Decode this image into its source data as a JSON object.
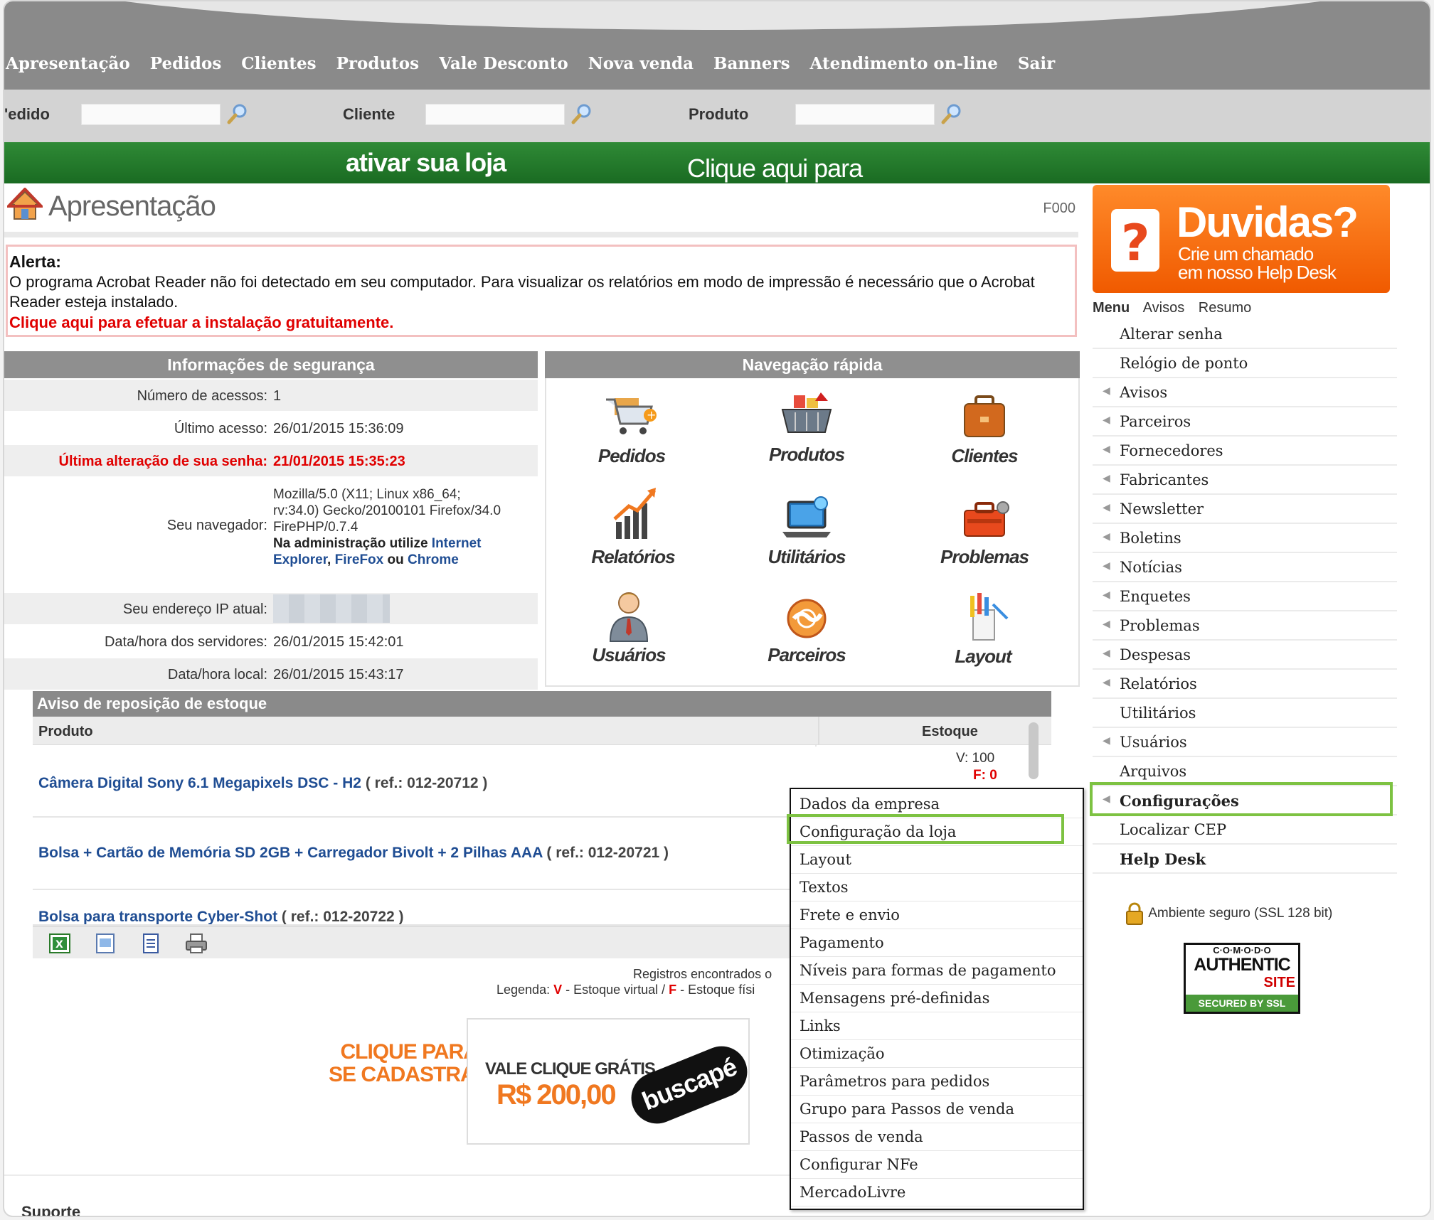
{
  "nav": {
    "items": [
      "Apresentação",
      "Pedidos",
      "Clientes",
      "Produtos",
      "Vale Desconto",
      "Nova venda",
      "Banners",
      "Atendimento on-line",
      "Sair"
    ]
  },
  "search": {
    "pedido_label": "'edido",
    "cliente_label": "Cliente",
    "produto_label": "Produto"
  },
  "banner": {
    "activate_prefix": "Clique aqui para ",
    "activate_bold": "ativar sua loja"
  },
  "page": {
    "title": "Apresentação",
    "code": "F000"
  },
  "alert": {
    "heading": "Alerta:",
    "text": "O programa Acrobat Reader não foi detectado em seu computador. Para visualizar os relatórios em modo de impressão é necessário que o Acrobat Reader esteja instalado.",
    "link": "Clique aqui para efetuar a instalação gratuitamente."
  },
  "security": {
    "heading": "Informações de segurança",
    "access_count_label": "Número de acessos:",
    "access_count": "1",
    "last_access_label": "Último acesso:",
    "last_access": "26/01/2015 15:36:09",
    "pw_change_label": "Última alteração de sua senha:",
    "pw_change": "21/01/2015 15:35:23",
    "browser_label": "Seu navegador:",
    "browser_line1": "Mozilla/5.0 (X11; Linux x86_64;",
    "browser_line2": "rv:34.0) Gecko/20100101 Firefox/34.0",
    "browser_line3": "FirePHP/0.7.4",
    "browser_tip_prefix": "Na administração utilize ",
    "browser_tip_link1": "Internet",
    "browser_tip_link1b": "Explorer",
    "browser_tip_link2": "FireFox",
    "browser_tip_or": " ou ",
    "browser_tip_link3": "Chrome",
    "ip_label": "Seu endereço IP atual:",
    "server_time_label": "Data/hora dos servidores:",
    "server_time": "26/01/2015 15:42:01",
    "local_time_label": "Data/hora local:",
    "local_time": "26/01/2015 15:43:17"
  },
  "quicknav": {
    "heading": "Navegação rápida",
    "items": [
      "Pedidos",
      "Produtos",
      "Clientes",
      "Relatórios",
      "Utilitários",
      "Problemas",
      "Usuários",
      "Parceiros",
      "Layout"
    ]
  },
  "stock": {
    "heading": "Aviso de reposição de estoque",
    "col_product": "Produto",
    "col_stock": "Estoque",
    "rows": [
      {
        "name": "Câmera Digital Sony 6.1 Megapixels DSC - H2",
        "ref": " ( ref.: 012-20712 )",
        "v": "V: 100",
        "f": "F: 0"
      },
      {
        "name": "Bolsa + Cartão de Memória SD 2GB + Carregador Bivolt + 2 Pilhas AAA",
        "ref": " ( ref.: 012-20721 )"
      },
      {
        "name": "Bolsa para transporte Cyber-Shot",
        "ref": " ( ref.: 012-20722 )"
      }
    ],
    "records_text": "Registros encontrados o",
    "legend_prefix": "Legenda: ",
    "legend_v": "V",
    "legend_v_text": " - Estoque virtual / ",
    "legend_f": "F",
    "legend_f_text": " - Estoque físi"
  },
  "promo": {
    "line1": "CLIQUE PARA",
    "line2": "SE CADASTRAR",
    "vale": "VALE CLIQUE GRÁTIS",
    "amount": "R$ 200,00",
    "brand": "buscapé"
  },
  "support_label": "Suporte",
  "help": {
    "title": "Duvidas?",
    "line1": "Crie um chamado",
    "line2": "em nosso Help Desk"
  },
  "sidebar": {
    "tabs": [
      "Menu",
      "Avisos",
      "Resumo"
    ],
    "items": [
      {
        "label": "Alterar senha",
        "arrow": false
      },
      {
        "label": "Relógio de ponto",
        "arrow": false
      },
      {
        "label": "Avisos",
        "arrow": true
      },
      {
        "label": "Parceiros",
        "arrow": true
      },
      {
        "label": "Fornecedores",
        "arrow": true
      },
      {
        "label": "Fabricantes",
        "arrow": true
      },
      {
        "label": "Newsletter",
        "arrow": true
      },
      {
        "label": "Boletins",
        "arrow": true
      },
      {
        "label": "Notícias",
        "arrow": true
      },
      {
        "label": "Enquetes",
        "arrow": true
      },
      {
        "label": "Problemas",
        "arrow": true
      },
      {
        "label": "Despesas",
        "arrow": true
      },
      {
        "label": "Relatórios",
        "arrow": true
      },
      {
        "label": "Utilitários",
        "arrow": false
      },
      {
        "label": "Usuários",
        "arrow": true
      },
      {
        "label": "Arquivos",
        "arrow": false
      },
      {
        "label": "Configurações",
        "arrow": true
      },
      {
        "label": "Localizar CEP",
        "arrow": false
      },
      {
        "label": "Help Desk",
        "arrow": false
      }
    ],
    "ssl_text": "Ambiente seguro (SSL 128 bit)",
    "comodo_top": "C·O·M·O·D·O",
    "comodo_mid": "AUTHENTIC",
    "comodo_site": "SITE",
    "comodo_bottom": "SECURED BY SSL"
  },
  "dropdown": {
    "items": [
      "Dados da empresa",
      "Configuração da loja",
      "Layout",
      "Textos",
      "Frete e envio",
      "Pagamento",
      "Níveis para formas de pagamento",
      "Mensagens pré-definidas",
      "Links",
      "Otimização",
      "Parâmetros para pedidos",
      "Grupo para Passos de venda",
      "Passos de venda",
      "Configurar NFe",
      "MercadoLivre"
    ],
    "highlighted": "Configuração da loja"
  },
  "colors": {
    "nav_bg": "#8a8a8a",
    "green_bar": "#2f8a36",
    "alert_red": "#e00000",
    "link_blue": "#1f4d93",
    "help_orange": "#f05a00",
    "highlight_green": "#7dc242"
  }
}
